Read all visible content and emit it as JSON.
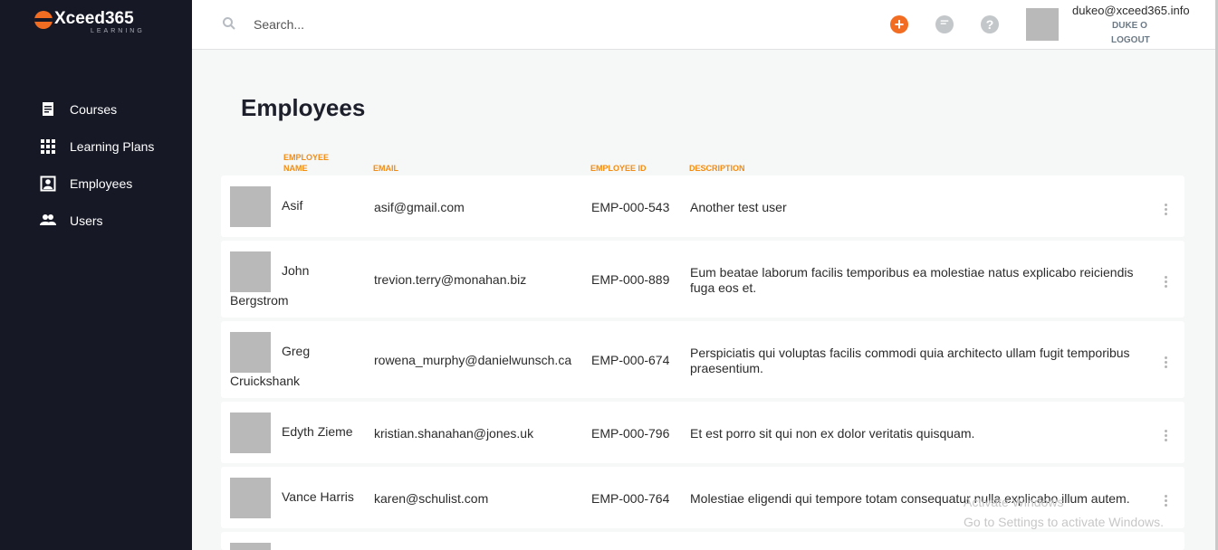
{
  "brand": {
    "name": "Xceed365",
    "sub": "LEARNING",
    "accent": "#f26d21",
    "sidebar_bg": "#161826",
    "header_accent": "#f28c13"
  },
  "sidebar": {
    "items": [
      {
        "label": "Courses",
        "icon": "document-icon"
      },
      {
        "label": "Learning Plans",
        "icon": "grid-icon"
      },
      {
        "label": "Employees",
        "icon": "contact-card-icon"
      },
      {
        "label": "Users",
        "icon": "users-icon"
      }
    ]
  },
  "topbar": {
    "search_placeholder": "Search...",
    "user_email": "dukeo@xceed365.info",
    "user_name": "DUKE O",
    "logout_label": "LOGOUT"
  },
  "main": {
    "title": "Employees",
    "columns": {
      "name": "EMPLOYEE NAME",
      "email": "EMAIL",
      "id": "EMPLOYEE ID",
      "description": "DESCRIPTION"
    },
    "rows": [
      {
        "first": "Asif",
        "last": "",
        "email": "asif@gmail.com",
        "id": "EMP-000-543",
        "description": "Another test user"
      },
      {
        "first": "John",
        "last": "Bergstrom",
        "email": "trevion.terry@monahan.biz",
        "id": "EMP-000-889",
        "description": "Eum beatae laborum facilis temporibus ea molestiae natus explicabo reiciendis fuga eos et."
      },
      {
        "first": "Greg",
        "last": "Cruickshank",
        "email": "rowena_murphy@danielwunsch.ca",
        "id": "EMP-000-674",
        "description": "Perspiciatis qui voluptas facilis commodi quia architecto ullam fugit temporibus praesentium."
      },
      {
        "first": "Edyth Zieme",
        "last": "",
        "email": "kristian.shanahan@jones.uk",
        "id": "EMP-000-796",
        "description": "Et est porro sit qui non ex dolor veritatis quisquam."
      },
      {
        "first": "Vance Harris",
        "last": "",
        "email": "karen@schulist.com",
        "id": "EMP-000-764",
        "description": "Molestiae eligendi qui tempore totam consequatur nulla explicabo illum autem."
      }
    ]
  },
  "watermark": {
    "line1": "Activate Windows",
    "line2": "Go to Settings to activate Windows."
  }
}
